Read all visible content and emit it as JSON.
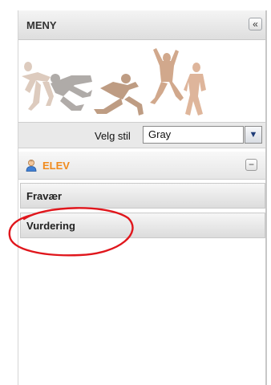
{
  "menu": {
    "title": "MENY",
    "collapse_icon": "double-chevron-left-icon"
  },
  "style_picker": {
    "label": "Velg stil",
    "selected": "Gray",
    "dropdown_icon": "chevron-down-icon"
  },
  "section": {
    "icon": "user-icon",
    "title": "ELEV",
    "title_color": "#f08a1c",
    "toggle_icon": "minus-icon"
  },
  "items": [
    {
      "label": "Fravær"
    },
    {
      "label": "Vurdering"
    }
  ],
  "annotation": {
    "color": "#e0161c"
  }
}
